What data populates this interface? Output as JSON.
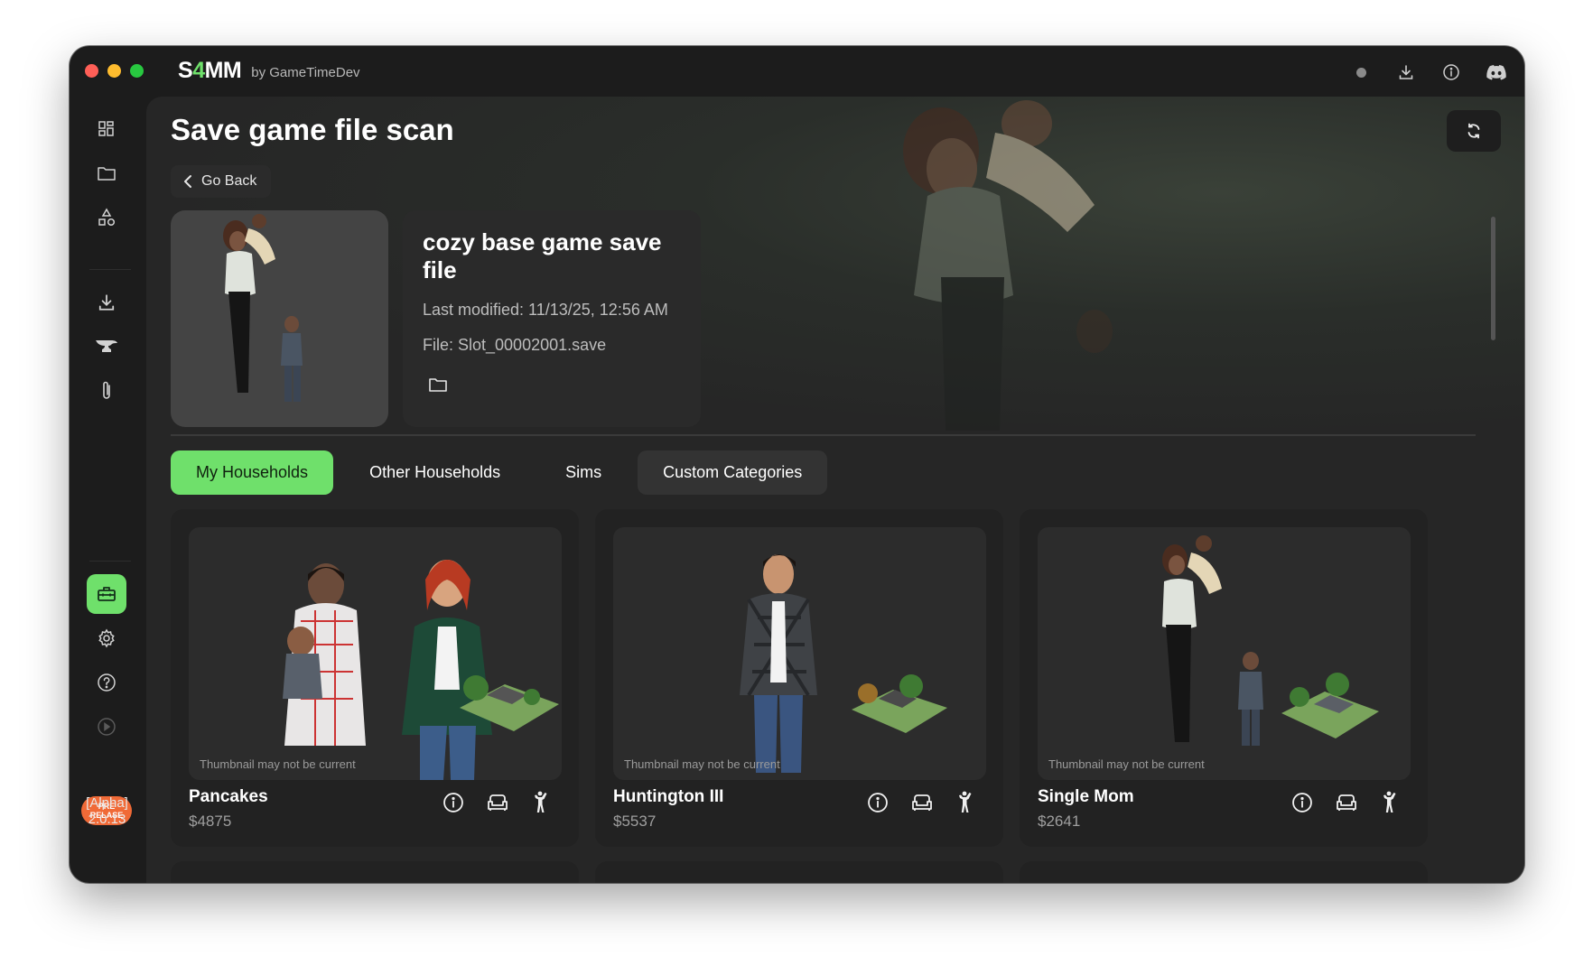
{
  "app": {
    "logo_prefix": "S",
    "logo_four": "4",
    "logo_suffix": "MM",
    "byline": "by GameTimeDev"
  },
  "sidebar": {
    "badge_line1": "PRE",
    "badge_line2": "RELASE",
    "version_line1": "[Alpha]",
    "version_line2": "2.0.13"
  },
  "page": {
    "title": "Save game file scan",
    "go_back": "Go Back"
  },
  "save": {
    "name": "cozy base game save file",
    "last_modified": "Last modified: 11/13/25, 12:56 AM",
    "file": "File: Slot_00002001.save"
  },
  "tabs": [
    {
      "label": "My Households"
    },
    {
      "label": "Other Households"
    },
    {
      "label": "Sims"
    },
    {
      "label": "Custom Categories"
    }
  ],
  "households": [
    {
      "name": "Pancakes",
      "funds": "$4875",
      "note": "Thumbnail may not be current"
    },
    {
      "name": "Huntington III",
      "funds": "$5537",
      "note": "Thumbnail may not be current"
    },
    {
      "name": "Single Mom",
      "funds": "$2641",
      "note": "Thumbnail may not be current"
    }
  ],
  "colors": {
    "accent": "#6fe06b",
    "badge": "#f06a37",
    "window_bg": "#1c1c1c",
    "panel_bg": "#262626"
  }
}
